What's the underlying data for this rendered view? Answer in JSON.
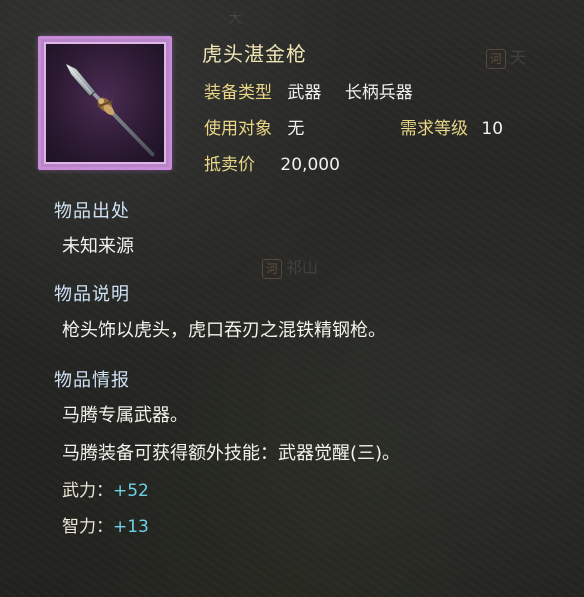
{
  "item": {
    "name": "虎头湛金枪",
    "rarity_color": "#c88bd8",
    "icon": "spear-icon"
  },
  "attributes": {
    "type_label": "装备类型",
    "type_value": "武器",
    "subtype_value": "长柄兵器",
    "target_label": "使用对象",
    "target_value": "无",
    "level_label": "需求等级",
    "level_value": "10",
    "price_label": "抵卖价",
    "price_value": "20,000"
  },
  "sections": {
    "origin_title": "物品出处",
    "origin_text": "未知来源",
    "desc_title": "物品说明",
    "desc_text": "枪头饰以虎头，虎口吞刃之混铁精钢枪。",
    "info_title": "物品情报",
    "info_line1": "马腾专属武器。",
    "info_line2": "马腾装备可获得额外技能：武器觉醒(三)。"
  },
  "stats": [
    {
      "label": "武力：",
      "value": "+52"
    },
    {
      "label": "智力：",
      "value": "+13"
    }
  ],
  "map_marks": {
    "mark1_badge": "河",
    "mark1_text": "天",
    "mark2_badge": "河",
    "mark2_text": "祁山",
    "mark3_text": "大"
  },
  "colors": {
    "label": "#e9d687",
    "section_title": "#cfe2f6",
    "stat_value": "#6fd1e6"
  }
}
